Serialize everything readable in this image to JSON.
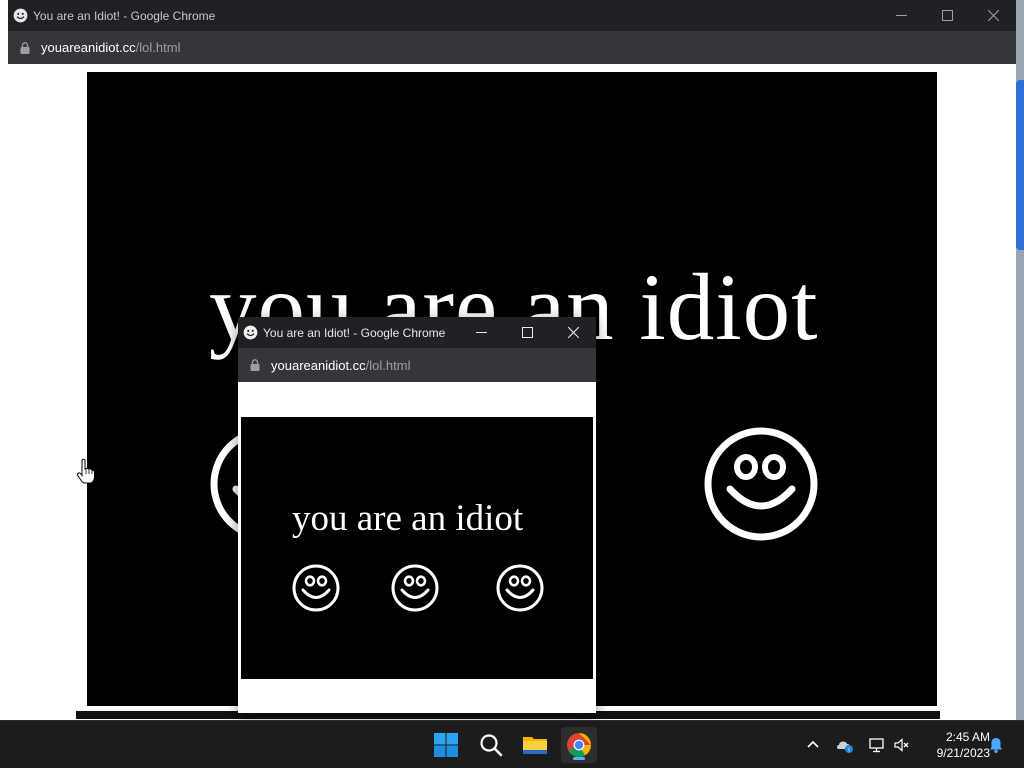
{
  "main_window": {
    "title": "You are an Idiot! - Google Chrome",
    "url_host": "youareanidiot.cc",
    "url_path": "/lol.html",
    "page_text": "you are an idiot"
  },
  "popup_window": {
    "title": "You are an Idiot! - Google Chrome",
    "url_host": "youareanidiot.cc",
    "url_path": "/lol.html",
    "page_text": "you are an idiot"
  },
  "taskbar": {
    "apps": [
      {
        "name": "Start",
        "icon": "windows-start-icon"
      },
      {
        "name": "Search",
        "icon": "search-icon"
      },
      {
        "name": "File Explorer",
        "icon": "folder-icon"
      },
      {
        "name": "Google Chrome",
        "icon": "chrome-icon",
        "active": true
      }
    ],
    "tray_icons": [
      "chevron-up-icon",
      "onedrive-icon",
      "network-icon",
      "volume-muted-icon",
      "notification-bell-icon"
    ],
    "time": "2:45 AM",
    "date": "9/21/2023"
  },
  "colors": {
    "titlebar": "#202124",
    "addressbar": "#35363a",
    "stage": "#000000",
    "foreground": "#ffffff",
    "taskbar": "#1c1c1c",
    "accent": "#5ab0f0"
  }
}
